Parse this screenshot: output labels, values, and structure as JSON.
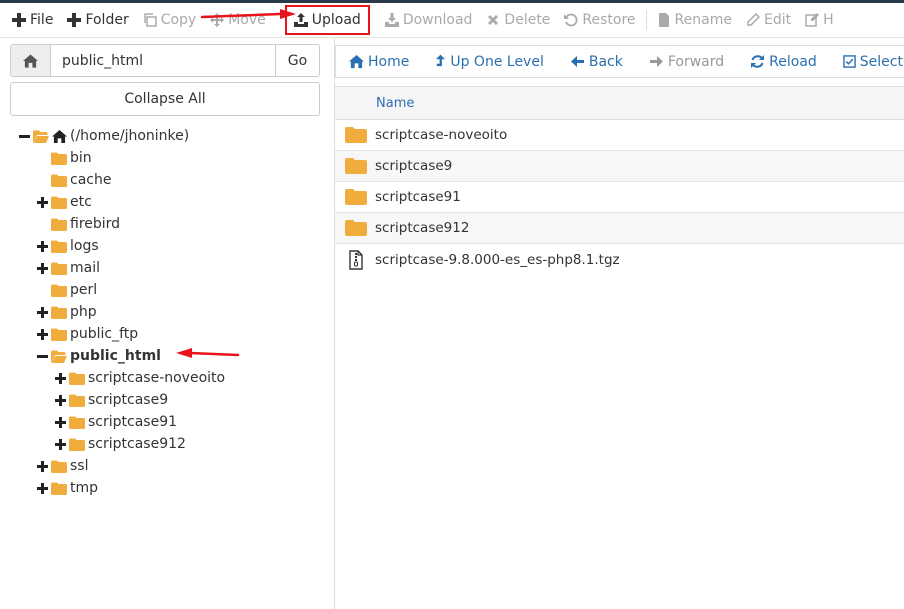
{
  "toolbar": {
    "buttons": [
      {
        "label": "File",
        "icon": "plus-icon",
        "enabled": true
      },
      {
        "label": "Folder",
        "icon": "plus-icon",
        "enabled": true
      },
      {
        "label": "Copy",
        "icon": "copy-icon",
        "enabled": false
      },
      {
        "label": "Move",
        "icon": "move-icon",
        "enabled": false
      },
      {
        "label": "Upload",
        "icon": "upload-icon",
        "enabled": true,
        "highlighted": true
      },
      {
        "label": "Download",
        "icon": "download-icon",
        "enabled": false
      },
      {
        "label": "Delete",
        "icon": "delete-icon",
        "enabled": false
      },
      {
        "label": "Restore",
        "icon": "restore-icon",
        "enabled": false
      },
      {
        "label": "Rename",
        "icon": "rename-icon",
        "enabled": false
      },
      {
        "label": "Edit",
        "icon": "edit-icon",
        "enabled": false
      },
      {
        "label": "H",
        "icon": "html-edit-icon",
        "enabled": false
      }
    ]
  },
  "path": {
    "home_icon": "home-icon",
    "value": "public_html",
    "go_label": "Go"
  },
  "collapse_label": "Collapse All",
  "tree": {
    "root": "(/home/jhoninke)",
    "items": [
      {
        "label": "bin",
        "level": 1,
        "toggle": ""
      },
      {
        "label": "cache",
        "level": 1,
        "toggle": ""
      },
      {
        "label": "etc",
        "level": 1,
        "toggle": "+"
      },
      {
        "label": "firebird",
        "level": 1,
        "toggle": ""
      },
      {
        "label": "logs",
        "level": 1,
        "toggle": "+"
      },
      {
        "label": "mail",
        "level": 1,
        "toggle": "+"
      },
      {
        "label": "perl",
        "level": 1,
        "toggle": ""
      },
      {
        "label": "php",
        "level": 1,
        "toggle": "+"
      },
      {
        "label": "public_ftp",
        "level": 1,
        "toggle": "+"
      },
      {
        "label": "public_html",
        "level": 1,
        "toggle": "-",
        "selected": true
      },
      {
        "label": "scriptcase-noveoito",
        "level": 2,
        "toggle": "+"
      },
      {
        "label": "scriptcase9",
        "level": 2,
        "toggle": "+"
      },
      {
        "label": "scriptcase91",
        "level": 2,
        "toggle": "+"
      },
      {
        "label": "scriptcase912",
        "level": 2,
        "toggle": "+"
      },
      {
        "label": "ssl",
        "level": 1,
        "toggle": "+"
      },
      {
        "label": "tmp",
        "level": 1,
        "toggle": "+"
      }
    ]
  },
  "nav": {
    "buttons": [
      {
        "label": "Home",
        "icon": "home-icon",
        "enabled": true
      },
      {
        "label": "Up One Level",
        "icon": "level-up-icon",
        "enabled": true
      },
      {
        "label": "Back",
        "icon": "back-arrow-icon",
        "enabled": true
      },
      {
        "label": "Forward",
        "icon": "forward-arrow-icon",
        "enabled": false
      },
      {
        "label": "Reload",
        "icon": "reload-icon",
        "enabled": true
      },
      {
        "label": "Select All",
        "icon": "checkbox-icon",
        "enabled": true
      }
    ]
  },
  "filelist": {
    "column_name": "Name",
    "rows": [
      {
        "name": "scriptcase-noveoito",
        "type": "folder"
      },
      {
        "name": "scriptcase9",
        "type": "folder"
      },
      {
        "name": "scriptcase91",
        "type": "folder"
      },
      {
        "name": "scriptcase912",
        "type": "folder"
      },
      {
        "name": "scriptcase-9.8.000-es_es-php8.1.tgz",
        "type": "archive"
      }
    ]
  },
  "colors": {
    "folder": "#f0ad3e",
    "link": "#2a6fb0",
    "highlight": "#e8141b",
    "topstrip": "#293a4a"
  }
}
